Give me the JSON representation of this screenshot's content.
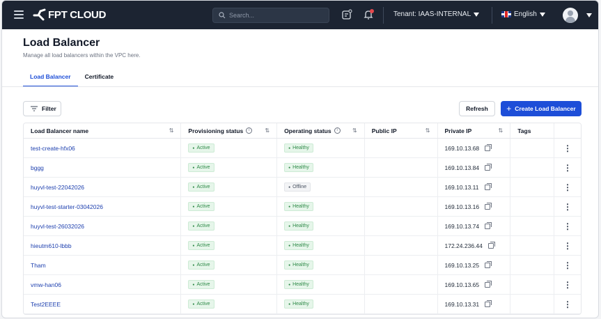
{
  "topbar": {
    "brand": "FPT CLOUD",
    "search_placeholder": "Search...",
    "tenant_label": "Tenant: IAAS-INTERNAL",
    "language": "English"
  },
  "page": {
    "title": "Load Balancer",
    "description": "Manage all load balancers within the VPC here.",
    "tabs": [
      {
        "label": "Load Balancer",
        "active": true
      },
      {
        "label": "Certificate",
        "active": false
      }
    ]
  },
  "toolbar": {
    "filter_label": "Filter",
    "refresh_label": "Refresh",
    "create_label": "Create Load Balancer"
  },
  "table": {
    "columns": {
      "name": "Load Balancer name",
      "provisioning": "Provisioning status",
      "operating": "Operating status",
      "public_ip": "Public IP",
      "private_ip": "Private IP",
      "tags": "Tags"
    },
    "rows": [
      {
        "name": "test-create-hfx06",
        "provisioning": "Active",
        "operating": "Healthy",
        "public_ip": "",
        "private_ip": "169.10.13.68"
      },
      {
        "name": "bggg",
        "provisioning": "Active",
        "operating": "Healthy",
        "public_ip": "",
        "private_ip": "169.10.13.84"
      },
      {
        "name": "huyvl-test-22042026",
        "provisioning": "Active",
        "operating": "Offline",
        "public_ip": "",
        "private_ip": "169.10.13.11"
      },
      {
        "name": "huyvl-test-starter-03042026",
        "provisioning": "Active",
        "operating": "Healthy",
        "public_ip": "",
        "private_ip": "169.10.13.16"
      },
      {
        "name": "huyvl-test-26032026",
        "provisioning": "Active",
        "operating": "Healthy",
        "public_ip": "",
        "private_ip": "169.10.13.74"
      },
      {
        "name": "hieutm610-lbbb",
        "provisioning": "Active",
        "operating": "Healthy",
        "public_ip": "",
        "private_ip": "172.24.236.44"
      },
      {
        "name": "Tham",
        "provisioning": "Active",
        "operating": "Healthy",
        "public_ip": "",
        "private_ip": "169.10.13.25"
      },
      {
        "name": "vmw-han06",
        "provisioning": "Active",
        "operating": "Healthy",
        "public_ip": "",
        "private_ip": "169.10.13.65"
      },
      {
        "name": "Test2EEEE",
        "provisioning": "Active",
        "operating": "Healthy",
        "public_ip": "",
        "private_ip": "169.10.13.31"
      }
    ]
  },
  "colors": {
    "topbar_bg": "#1c2432",
    "accent": "#1d4ed8",
    "healthy_green": "#2f8a48",
    "link": "#1e40af"
  },
  "icons": [
    "menu-icon",
    "fpt-logo-icon",
    "search-icon",
    "notes-icon",
    "bell-icon",
    "uk-flag-icon",
    "avatar-icon",
    "filter-icon",
    "plus-icon",
    "sort-icon",
    "info-icon",
    "copy-icon",
    "kebab-menu-icon"
  ]
}
